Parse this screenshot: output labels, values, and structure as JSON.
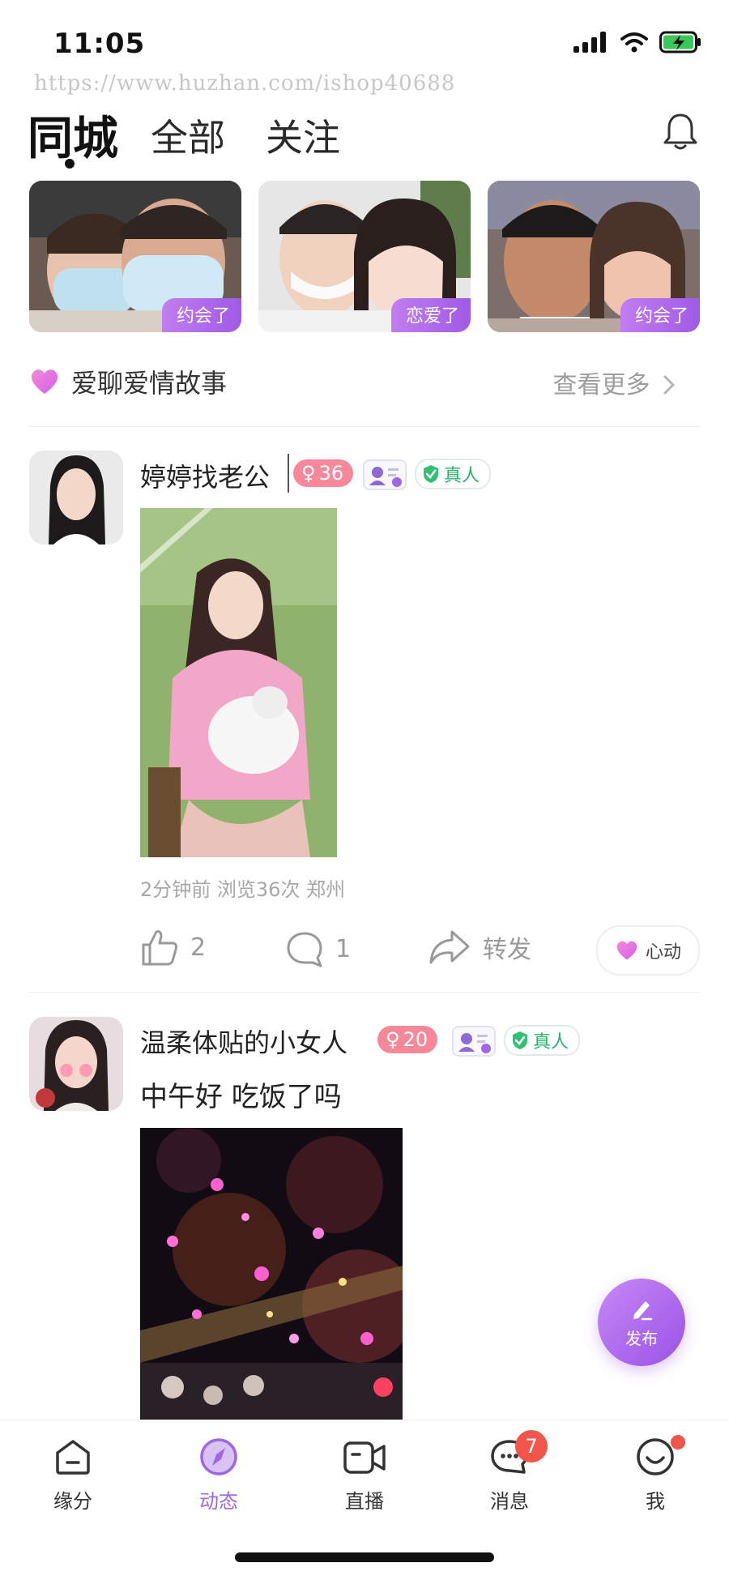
{
  "status_bar": {
    "time": "11:05"
  },
  "watermark": "https://www.huzhan.com/ishop40688",
  "tabs": [
    {
      "label": "同城",
      "active": true
    },
    {
      "label": "全部",
      "active": false
    },
    {
      "label": "关注",
      "active": false
    }
  ],
  "story_cards": [
    {
      "badge": "约会了"
    },
    {
      "badge": "恋爱了"
    },
    {
      "badge": "约会了"
    }
  ],
  "love_stories": {
    "title": "爱聊爱情故事",
    "more": "查看更多"
  },
  "posts": [
    {
      "username": "婷婷找老公",
      "age": "36",
      "real_label": "真人",
      "text": "",
      "meta": "2分钟前 浏览36次 郑州",
      "likes": "2",
      "comments": "1",
      "share_label": "转发",
      "heart_label": "心动"
    },
    {
      "username": "温柔体贴的小女人",
      "age": "20",
      "real_label": "真人",
      "text": "中午好 吃饭了吗"
    }
  ],
  "fab": {
    "label": "发布"
  },
  "bottom_nav": [
    {
      "label": "缘分",
      "icon": "home-icon",
      "active": false
    },
    {
      "label": "动态",
      "icon": "compass-icon",
      "active": true
    },
    {
      "label": "直播",
      "icon": "video-icon",
      "active": false
    },
    {
      "label": "消息",
      "icon": "message-icon",
      "active": false,
      "badge": "7"
    },
    {
      "label": "我",
      "icon": "smile-icon",
      "active": false,
      "dot": true
    }
  ],
  "colors": {
    "accent": "#a066e8",
    "age_badge": "#f7889a",
    "real_badge": "#27b36b",
    "notify": "#f2564a"
  }
}
